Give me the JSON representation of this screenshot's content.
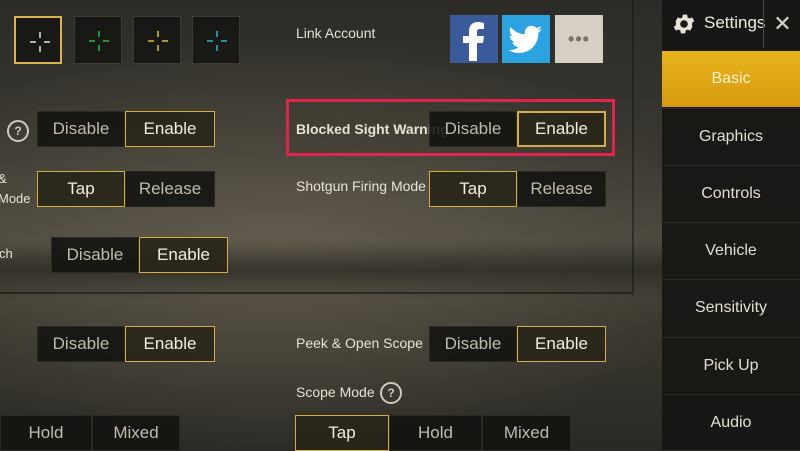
{
  "account": {
    "label": "Link Account"
  },
  "social": {
    "more_label": "•••"
  },
  "rows": {
    "row1": {
      "disable": "Disable",
      "enable": "Enable"
    },
    "row2": {
      "label_partial_1": "&",
      "label_partial_2": "Mode",
      "tap": "Tap",
      "release": "Release"
    },
    "row3": {
      "label_partial": "ch",
      "disable": "Disable",
      "enable": "Enable"
    },
    "row4": {
      "disable": "Disable",
      "enable": "Enable"
    },
    "row5": {
      "hold": "Hold",
      "mixed": "Mixed"
    },
    "blocked_sight": {
      "label": "Blocked Sight Warning",
      "disable": "Disable",
      "enable": "Enable"
    },
    "shotgun": {
      "label": "Shotgun Firing Mode",
      "tap": "Tap",
      "release": "Release"
    },
    "peek": {
      "label": "Peek & Open Scope",
      "disable": "Disable",
      "enable": "Enable"
    },
    "scope": {
      "label": "Scope Mode",
      "tap": "Tap",
      "hold": "Hold",
      "mixed": "Mixed"
    }
  },
  "help_icon": "?",
  "sidebar": {
    "title": "Settings",
    "close": "✕",
    "items": [
      {
        "label": "Basic"
      },
      {
        "label": "Graphics"
      },
      {
        "label": "Controls"
      },
      {
        "label": "Vehicle"
      },
      {
        "label": "Sensitivity"
      },
      {
        "label": "Pick Up"
      },
      {
        "label": "Audio"
      }
    ]
  },
  "colors": {
    "crosshair_white": "#e6e2d4",
    "crosshair_green": "#22c04a",
    "crosshair_yellow": "#e0c030",
    "crosshair_cyan": "#20b8d8",
    "accent": "#d4ae45",
    "highlight": "#e0254d"
  }
}
